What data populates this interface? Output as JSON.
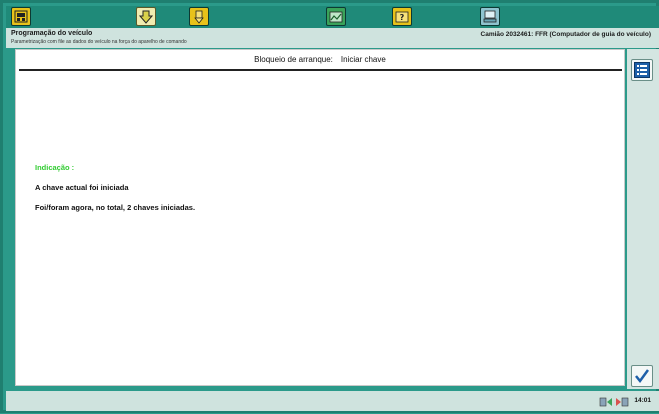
{
  "toolbar": {
    "buttons": [
      {
        "icon": "vehicle-home-icon",
        "color": "#e8c21a"
      },
      {
        "icon": "download-arrow-icon",
        "color": "#d9d14a",
        "active": true
      },
      {
        "icon": "info-icon",
        "color": "#e8c21a"
      },
      {
        "icon": "graph-icon",
        "color": "#3aa35a"
      },
      {
        "icon": "help-icon",
        "color": "#e8c21a"
      },
      {
        "icon": "computer-icon",
        "color": "#6aa8b8"
      }
    ]
  },
  "infobar": {
    "title": "Programação do veículo",
    "subtitle": "Parametrização com file as dados do veículo na força do aparelho de comando",
    "vehicle": "Camião 2032461: FFR (Computador de guia do veículo)"
  },
  "content": {
    "header_label": "Bloqueio de arranque:",
    "header_value": "Iniciar chave",
    "indication_label": "Indicação :",
    "message_1": "A chave actual foi iniciada",
    "message_2": "Foi/foram agora, no total, 2 chaves iniciadas."
  },
  "sidebar": {
    "list_button": "list-icon",
    "confirm_button": "checkmark-icon"
  },
  "status": {
    "time": "14:01",
    "icons": "connection-status-icon"
  },
  "colors": {
    "frame": "#2b9a8a",
    "indication": "#33cc33",
    "accent_blue": "#1d5fa8"
  }
}
